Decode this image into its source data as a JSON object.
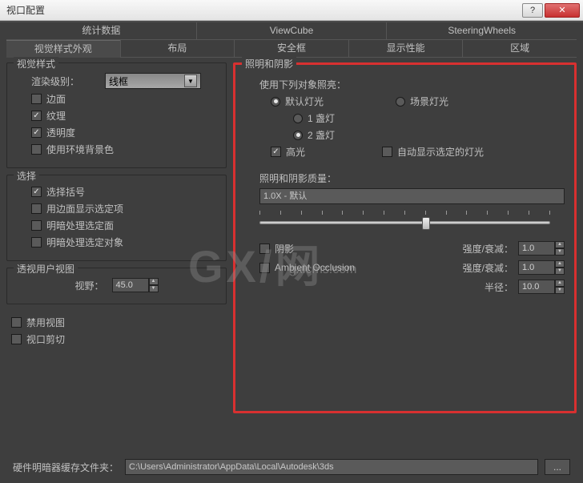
{
  "window": {
    "title": "视口配置"
  },
  "tabs1": [
    "统计数据",
    "ViewCube",
    "SteeringWheels"
  ],
  "tabs2": [
    "视觉样式外观",
    "布局",
    "安全框",
    "显示性能",
    "区域"
  ],
  "visualStyle": {
    "legend": "视觉样式",
    "renderLevelLabel": "渲染级别：",
    "renderLevelValue": "线框",
    "cb_edge": "边面",
    "cb_texture": "纹理",
    "cb_transparent": "透明度",
    "cb_envbg": "使用环境背景色"
  },
  "selection": {
    "legend": "选择",
    "cb_bracket": "选择括号",
    "cb_edgeShow": "用边面显示选定项",
    "cb_shadeFace": "明暗处理选定面",
    "cb_shadeObj": "明暗处理选定对象"
  },
  "perspective": {
    "legend": "透视用户视图",
    "fovLabel": "视野：",
    "fovValue": "45.0"
  },
  "cb_disable": "禁用视图",
  "cb_clip": "视口剪切",
  "lighting": {
    "legend": "照明和阴影",
    "useLabel": "使用下列对象照亮：",
    "rb_default": "默认灯光",
    "rb_scene": "场景灯光",
    "rb_1light": "1 盏灯",
    "rb_2light": "2 盏灯",
    "cb_highlight": "高光",
    "cb_autoshow": "自动显示选定的灯光",
    "qualityLabel": "照明和阴影质量：",
    "qualitySelect": "1.0X - 默认",
    "cb_shadow": "阴影",
    "shadowIntensity": "强度/衰减：",
    "shadowVal": "1.0",
    "cb_ao": "Ambient Occlusion",
    "aoIntensity": "强度/衰减：",
    "aoVal": "1.0",
    "radiusLabel": "半径：",
    "radiusVal": "10.0"
  },
  "bottom": {
    "label": "硬件明暗器缓存文件夹：",
    "path": "C:\\Users\\Administrator\\AppData\\Local\\Autodesk\\3ds",
    "browse": "..."
  },
  "watermark": {
    "main": "GX/网",
    "sub": "gxlcms.com"
  }
}
